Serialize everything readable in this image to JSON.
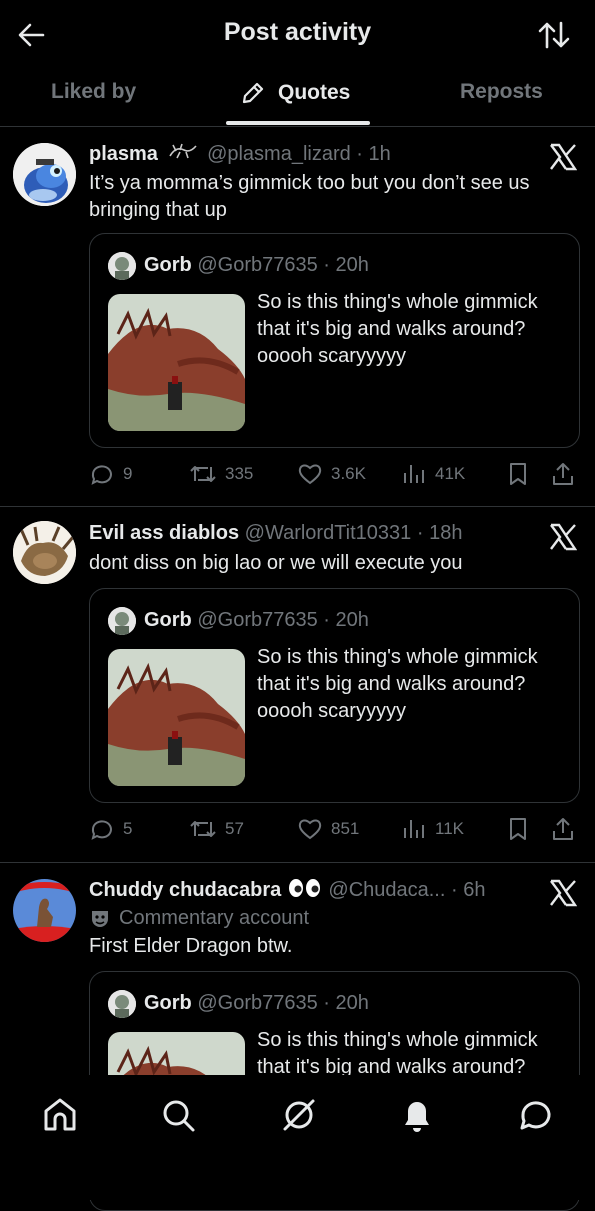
{
  "header": {
    "title": "Post activity"
  },
  "tabs": [
    {
      "label": "Liked by"
    },
    {
      "label": "Quotes"
    },
    {
      "label": "Reposts"
    }
  ],
  "quoted_post": {
    "name": "Gorb",
    "meta": "@Gorb77635 · 20h",
    "text": "So is this thing's whole gimmick that it's big and walks around? ooooh scaryyyyy"
  },
  "posts": [
    {
      "name": "plasma",
      "meta": "@plasma_lizard · 1h",
      "text": "It’s ya momma’s gimmick too but you don’t see us bringing that up",
      "replies": "9",
      "reposts": "335",
      "likes": "3.6K",
      "views": "41K"
    },
    {
      "name": "Evil ass diablos",
      "meta": "@WarlordTit10331 · 18h",
      "text": "dont diss on big lao or we will execute you",
      "replies": "5",
      "reposts": "57",
      "likes": "851",
      "views": "11K"
    },
    {
      "name": "Chuddy chudacabra",
      "meta": "@Chudaca... · 6h",
      "label": "Commentary account",
      "text": "First Elder Dragon btw."
    }
  ],
  "icons": {
    "back": "arrow-left-icon",
    "sort": "sort-arrows-icon",
    "x": "x-logo-icon",
    "nav": [
      "home-icon",
      "search-icon",
      "grok-icon",
      "notifications-icon",
      "messages-icon"
    ]
  },
  "colors": {
    "background": "#000000",
    "text": "#e7e9ea",
    "secondary": "#71767b",
    "border": "#2f3336"
  }
}
